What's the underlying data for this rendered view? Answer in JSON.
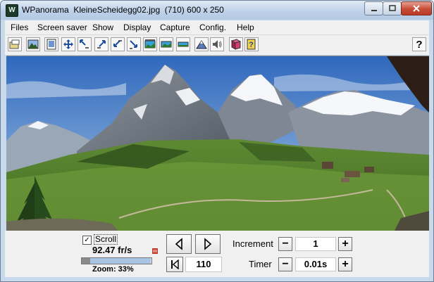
{
  "window": {
    "title": "WPanorama  KleineScheidegg02.jpg  (710) 600 x 250",
    "app_icon_letter": "W"
  },
  "menu": {
    "items": [
      "Files",
      "Screen saver",
      "Show",
      "Display",
      "Capture",
      "Config.",
      "Help"
    ]
  },
  "toolbar": {
    "icons": [
      "open-file-icon",
      "landscape-image-icon",
      "fit-page-icon",
      "move-arrows-icon",
      "shrink-up-left-icon",
      "expand-up-right-icon",
      "shrink-down-left-icon",
      "expand-down-right-icon",
      "panorama-strip-icon",
      "panorama-wide-icon",
      "panorama-narrow-icon",
      "mountain-icon",
      "sound-icon",
      "book-icon",
      "help-book-icon",
      "help-question-icon"
    ],
    "help_label": "?"
  },
  "controls": {
    "scroll_checked": true,
    "scroll_label": "Scroll",
    "speed_text": "92.47 fr/s",
    "zoom_text": "Zoom: 33%",
    "zoom_fraction": 0.33,
    "position_value": "110",
    "increment_label": "Increment",
    "increment_value": "1",
    "timer_label": "Timer",
    "timer_value": "0.01s",
    "minus_label": "−",
    "plus_label": "+"
  },
  "colors": {
    "titlebar": "#bcd0e8",
    "close_button": "#c74b37",
    "panel_bg": "#f0f0f0",
    "sky": "#3f78c8"
  }
}
